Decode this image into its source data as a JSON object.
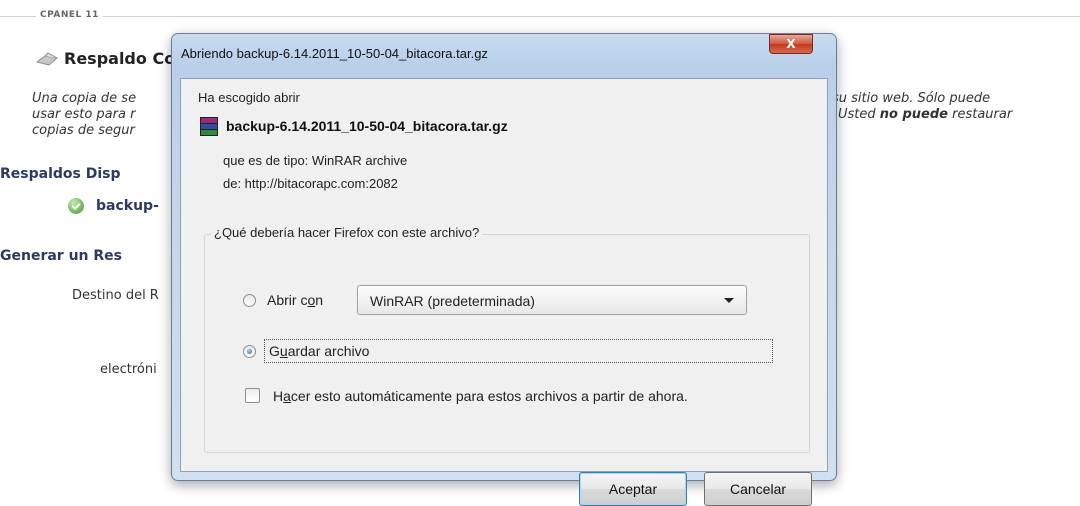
{
  "background": {
    "brand": "CPANEL 11",
    "page_title": "Respaldo Co",
    "intro_left": [
      "Una copia de se",
      "usar esto para r",
      "copias de segur"
    ],
    "intro_right_1": "su sitio web. Sólo puede",
    "intro_right_2_pre": "Usted ",
    "intro_right_2_bold": "no puede",
    "intro_right_2_post": " restaurar",
    "available_heading": "Respaldos Disp",
    "backup_link": "backup-",
    "generate_heading": "Generar un Res",
    "destination_label": "Destino del R",
    "email_label": "electróni"
  },
  "dialog": {
    "title": "Abriendo backup-6.14.2011_10-50-04_bitacora.tar.gz",
    "close_label": "X",
    "chosen_text": "Ha escogido abrir",
    "file_name": "backup-6.14.2011_10-50-04_bitacora.tar.gz",
    "type_text": "que es de tipo:  WinRAR archive",
    "from_text": "de:  http://bitacorapc.com:2082",
    "question": "¿Qué debería hacer Firefox con este archivo?",
    "open_with_pre": "Abrir c",
    "open_with_u": "o",
    "open_with_post": "n",
    "open_with_app": "WinRAR (predeterminada)",
    "save_pre": "G",
    "save_u": "u",
    "save_post": "ardar archivo",
    "auto_pre": "H",
    "auto_u": "a",
    "auto_post": "cer esto automáticamente para estos archivos a partir de ahora.",
    "ok_label": "Aceptar",
    "cancel_label": "Cancelar",
    "selected_option": "Guardar archivo",
    "auto_checked": false
  }
}
